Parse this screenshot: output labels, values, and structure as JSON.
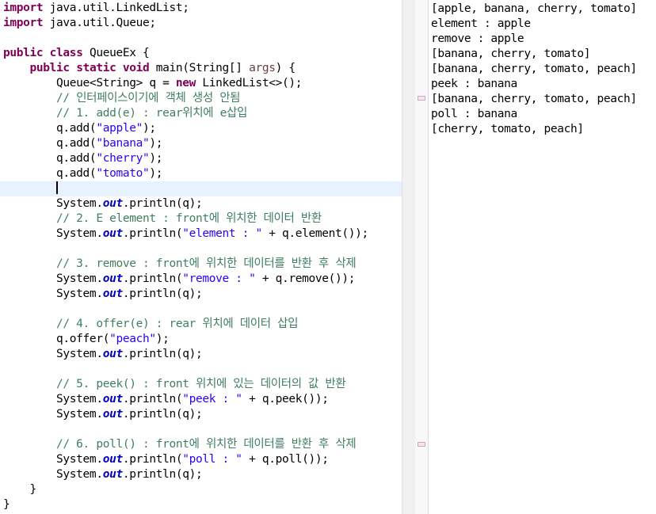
{
  "editor": {
    "lines": [
      [
        {
          "t": "import",
          "c": "kw"
        },
        {
          "t": " java.util.LinkedList;"
        }
      ],
      [
        {
          "t": "import",
          "c": "kw"
        },
        {
          "t": " java.util.Queue;"
        }
      ],
      [],
      [
        {
          "t": "public class",
          "c": "kw"
        },
        {
          "t": " QueueEx {"
        }
      ],
      [
        {
          "t": "    "
        },
        {
          "t": "public static void",
          "c": "kw"
        },
        {
          "t": " main(String[] "
        },
        {
          "t": "args",
          "c": "param"
        },
        {
          "t": ") {"
        }
      ],
      [
        {
          "t": "        Queue<String> q = "
        },
        {
          "t": "new",
          "c": "kw"
        },
        {
          "t": " LinkedList<>();"
        }
      ],
      [
        {
          "t": "        // 인터페이스이기에 객체 생성 안됨",
          "c": "cmt"
        }
      ],
      [
        {
          "t": "        // 1. add(e) : rear위치에 e삽입",
          "c": "cmt"
        }
      ],
      [
        {
          "t": "        q.add("
        },
        {
          "t": "\"apple\"",
          "c": "str"
        },
        {
          "t": ");"
        }
      ],
      [
        {
          "t": "        q.add("
        },
        {
          "t": "\"banana\"",
          "c": "str"
        },
        {
          "t": ");"
        }
      ],
      [
        {
          "t": "        q.add("
        },
        {
          "t": "\"cherry\"",
          "c": "str"
        },
        {
          "t": ");"
        }
      ],
      [
        {
          "t": "        q.add("
        },
        {
          "t": "\"tomato\"",
          "c": "str"
        },
        {
          "t": ");"
        }
      ],
      [
        {
          "t": "        "
        }
      ],
      [
        {
          "t": "        System."
        },
        {
          "t": "out",
          "c": "fld"
        },
        {
          "t": ".println(q);"
        }
      ],
      [
        {
          "t": "        // 2. E element : front에 위치한 데이터 반환",
          "c": "cmt"
        }
      ],
      [
        {
          "t": "        System."
        },
        {
          "t": "out",
          "c": "fld"
        },
        {
          "t": ".println("
        },
        {
          "t": "\"element : \"",
          "c": "str"
        },
        {
          "t": " + q.element());"
        }
      ],
      [],
      [
        {
          "t": "        // 3. remove : front에 위치한 데이터를 반환 후 삭제",
          "c": "cmt"
        }
      ],
      [
        {
          "t": "        System."
        },
        {
          "t": "out",
          "c": "fld"
        },
        {
          "t": ".println("
        },
        {
          "t": "\"remove : \"",
          "c": "str"
        },
        {
          "t": " + q.remove());"
        }
      ],
      [
        {
          "t": "        System."
        },
        {
          "t": "out",
          "c": "fld"
        },
        {
          "t": ".println(q);"
        }
      ],
      [],
      [
        {
          "t": "        // 4. offer(e) : rear 위치에 데이터 삽입",
          "c": "cmt"
        }
      ],
      [
        {
          "t": "        q.offer("
        },
        {
          "t": "\"peach\"",
          "c": "str"
        },
        {
          "t": ");"
        }
      ],
      [
        {
          "t": "        System."
        },
        {
          "t": "out",
          "c": "fld"
        },
        {
          "t": ".println(q);"
        }
      ],
      [],
      [
        {
          "t": "        // 5. peek() : front 위치에 있는 데이터의 값 반환",
          "c": "cmt"
        }
      ],
      [
        {
          "t": "        System."
        },
        {
          "t": "out",
          "c": "fld"
        },
        {
          "t": ".println("
        },
        {
          "t": "\"peek : \"",
          "c": "str"
        },
        {
          "t": " + q.peek());"
        }
      ],
      [
        {
          "t": "        System."
        },
        {
          "t": "out",
          "c": "fld"
        },
        {
          "t": ".println(q);"
        }
      ],
      [],
      [
        {
          "t": "        // 6. poll() : front에 위치한 데이터를 반환 후 삭제",
          "c": "cmt"
        }
      ],
      [
        {
          "t": "        System."
        },
        {
          "t": "out",
          "c": "fld"
        },
        {
          "t": ".println("
        },
        {
          "t": "\"poll : \"",
          "c": "str"
        },
        {
          "t": " + q.poll());"
        }
      ],
      [
        {
          "t": "        System."
        },
        {
          "t": "out",
          "c": "fld"
        },
        {
          "t": ".println(q);"
        }
      ],
      [
        {
          "t": "    }"
        }
      ],
      [
        {
          "t": "}"
        }
      ]
    ],
    "current_line_index": 12
  },
  "console": {
    "lines": [
      "[apple, banana, cherry, tomato]",
      "element : apple",
      "remove : apple",
      "[banana, cherry, tomato]",
      "[banana, cherry, tomato, peach]",
      "peek : banana",
      "[banana, cherry, tomato, peach]",
      "poll : banana",
      "[cherry, tomato, peach]"
    ]
  },
  "colors": {
    "keyword": "#7f0055",
    "string": "#2a00ff",
    "comment": "#3f7f5f",
    "static_field": "#0000c0",
    "parameter": "#6a3e3e",
    "current_line": "#e8f2fe"
  }
}
